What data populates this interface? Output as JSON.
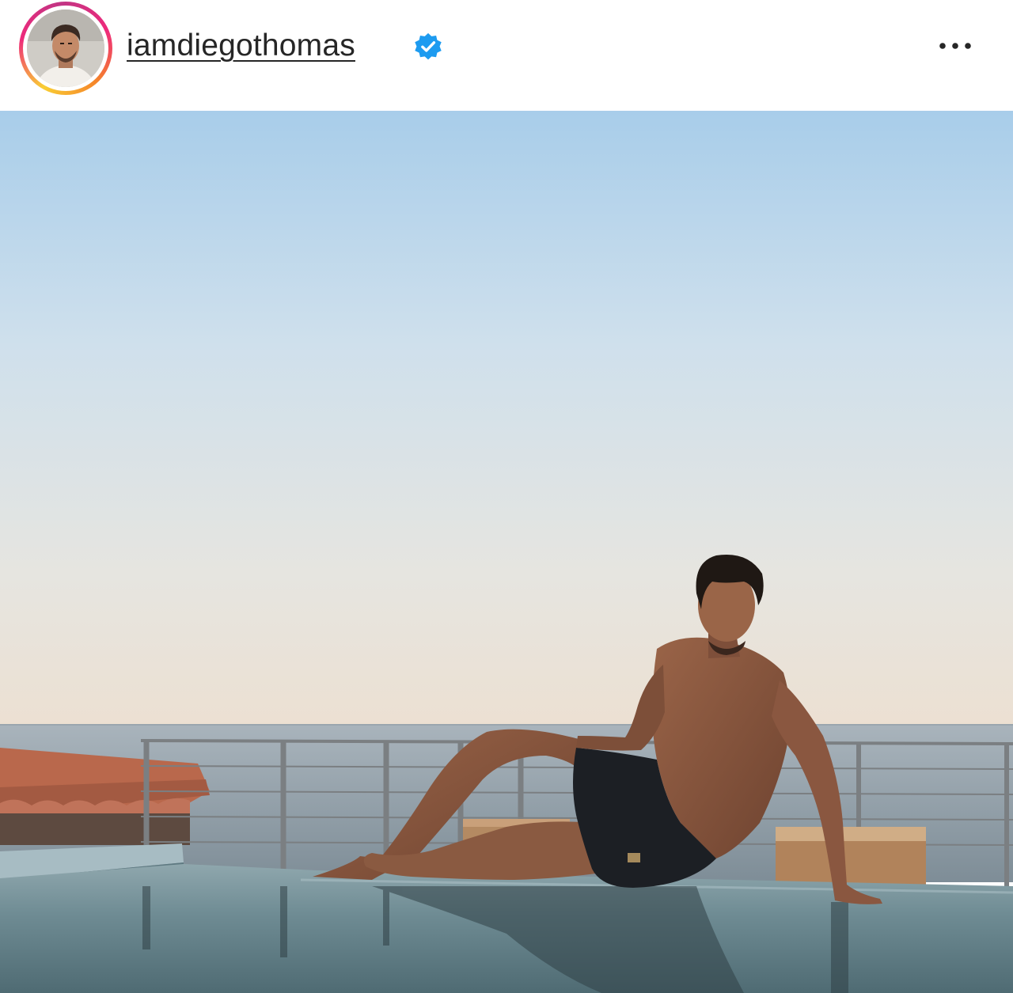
{
  "post": {
    "username": "iamdiegothomas",
    "verified": true,
    "verified_badge_color": "#1d9bf0",
    "icons": {
      "verified": "verified-badge-icon",
      "menu": "more-options-icon"
    },
    "story_ring_colors": [
      "#f9ce34",
      "#ee2a7b",
      "#c13584",
      "#f58529"
    ]
  }
}
